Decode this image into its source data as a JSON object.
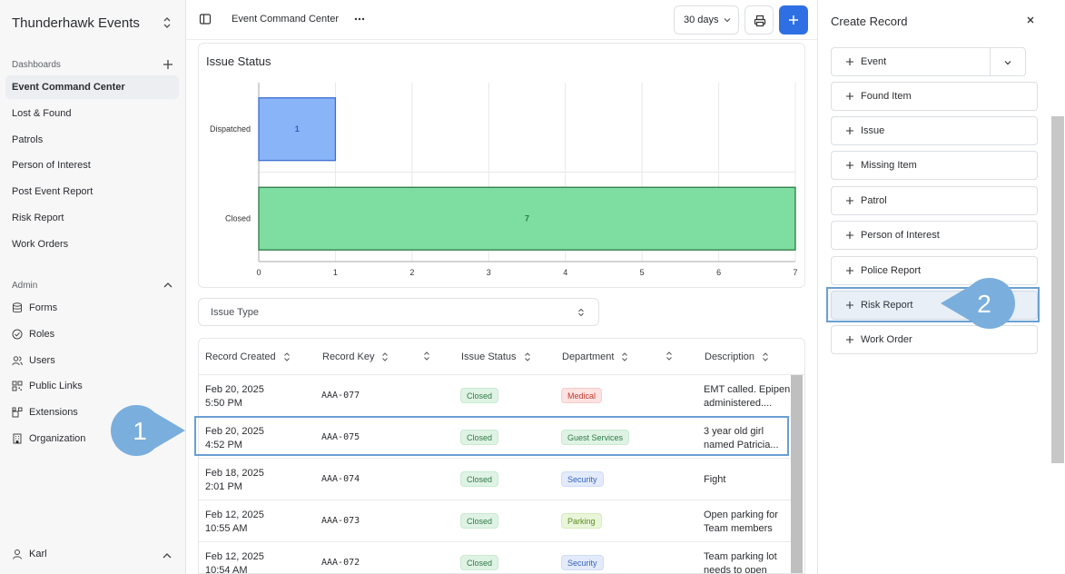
{
  "sidebar": {
    "workspace": "Thunderhawk Events",
    "dashboards_label": "Dashboards",
    "dashboards": [
      "Event Command Center",
      "Lost & Found",
      "Patrols",
      "Person of Interest",
      "Post Event Report",
      "Risk Report",
      "Work Orders"
    ],
    "admin_label": "Admin",
    "admin": [
      "Forms",
      "Roles",
      "Users",
      "Public Links",
      "Extensions",
      "Organization"
    ],
    "user": "Karl"
  },
  "topbar": {
    "page_name": "Event Command Center",
    "range": "30 days"
  },
  "chart": {
    "title": "Issue Status"
  },
  "chart_data": {
    "type": "bar",
    "orientation": "horizontal",
    "title": "Issue Status",
    "categories": [
      "Dispatched",
      "Closed"
    ],
    "values": [
      1,
      7
    ],
    "colors": [
      "#8ab4f8",
      "#7edda0"
    ],
    "xlim": [
      0,
      7
    ],
    "xticks": [
      "0",
      "1",
      "2",
      "3",
      "4",
      "5",
      "6",
      "7"
    ],
    "grid": true
  },
  "filter": {
    "label": "Issue Type"
  },
  "table": {
    "headers": [
      "Record Created",
      "Record Key",
      "Issue Status",
      "Department",
      "Description"
    ],
    "rows": [
      {
        "date": "Feb 20, 2025",
        "time": "5:50 PM",
        "key": "AAA-077",
        "status": "Closed",
        "dept": "Medical",
        "desc1": "EMT called. Epipen",
        "desc2": "administered...."
      },
      {
        "date": "Feb 20, 2025",
        "time": "4:52 PM",
        "key": "AAA-075",
        "status": "Closed",
        "dept": "Guest Services",
        "desc1": "3 year old girl",
        "desc2": "named Patricia..."
      },
      {
        "date": "Feb 18, 2025",
        "time": "2:01 PM",
        "key": "AAA-074",
        "status": "Closed",
        "dept": "Security",
        "desc1": "Fight",
        "desc2": ""
      },
      {
        "date": "Feb 12, 2025",
        "time": "10:55 AM",
        "key": "AAA-073",
        "status": "Closed",
        "dept": "Parking",
        "desc1": "Open parking for",
        "desc2": "Team members"
      },
      {
        "date": "Feb 12, 2025",
        "time": "10:54 AM",
        "key": "AAA-072",
        "status": "Closed",
        "dept": "Security",
        "desc1": "Team parking lot",
        "desc2": "needs to open"
      }
    ]
  },
  "create_panel": {
    "title": "Create Record",
    "items": [
      "Event",
      "Found Item",
      "Issue",
      "Missing Item",
      "Patrol",
      "Person of Interest",
      "Police Report",
      "Risk Report",
      "Work Order"
    ]
  },
  "callouts": [
    "1",
    "2"
  ],
  "colors": {
    "accent": "#2f6fe4",
    "callout": "#7aaedd",
    "medical_bg": "#fde2e2",
    "medical_fg": "#c0392b",
    "guest_bg": "#dff3e5",
    "guest_fg": "#2f7a44",
    "security_bg": "#e3ebfb",
    "security_fg": "#3561c2",
    "parking_bg": "#eaf6d9",
    "parking_fg": "#5a8a22"
  }
}
